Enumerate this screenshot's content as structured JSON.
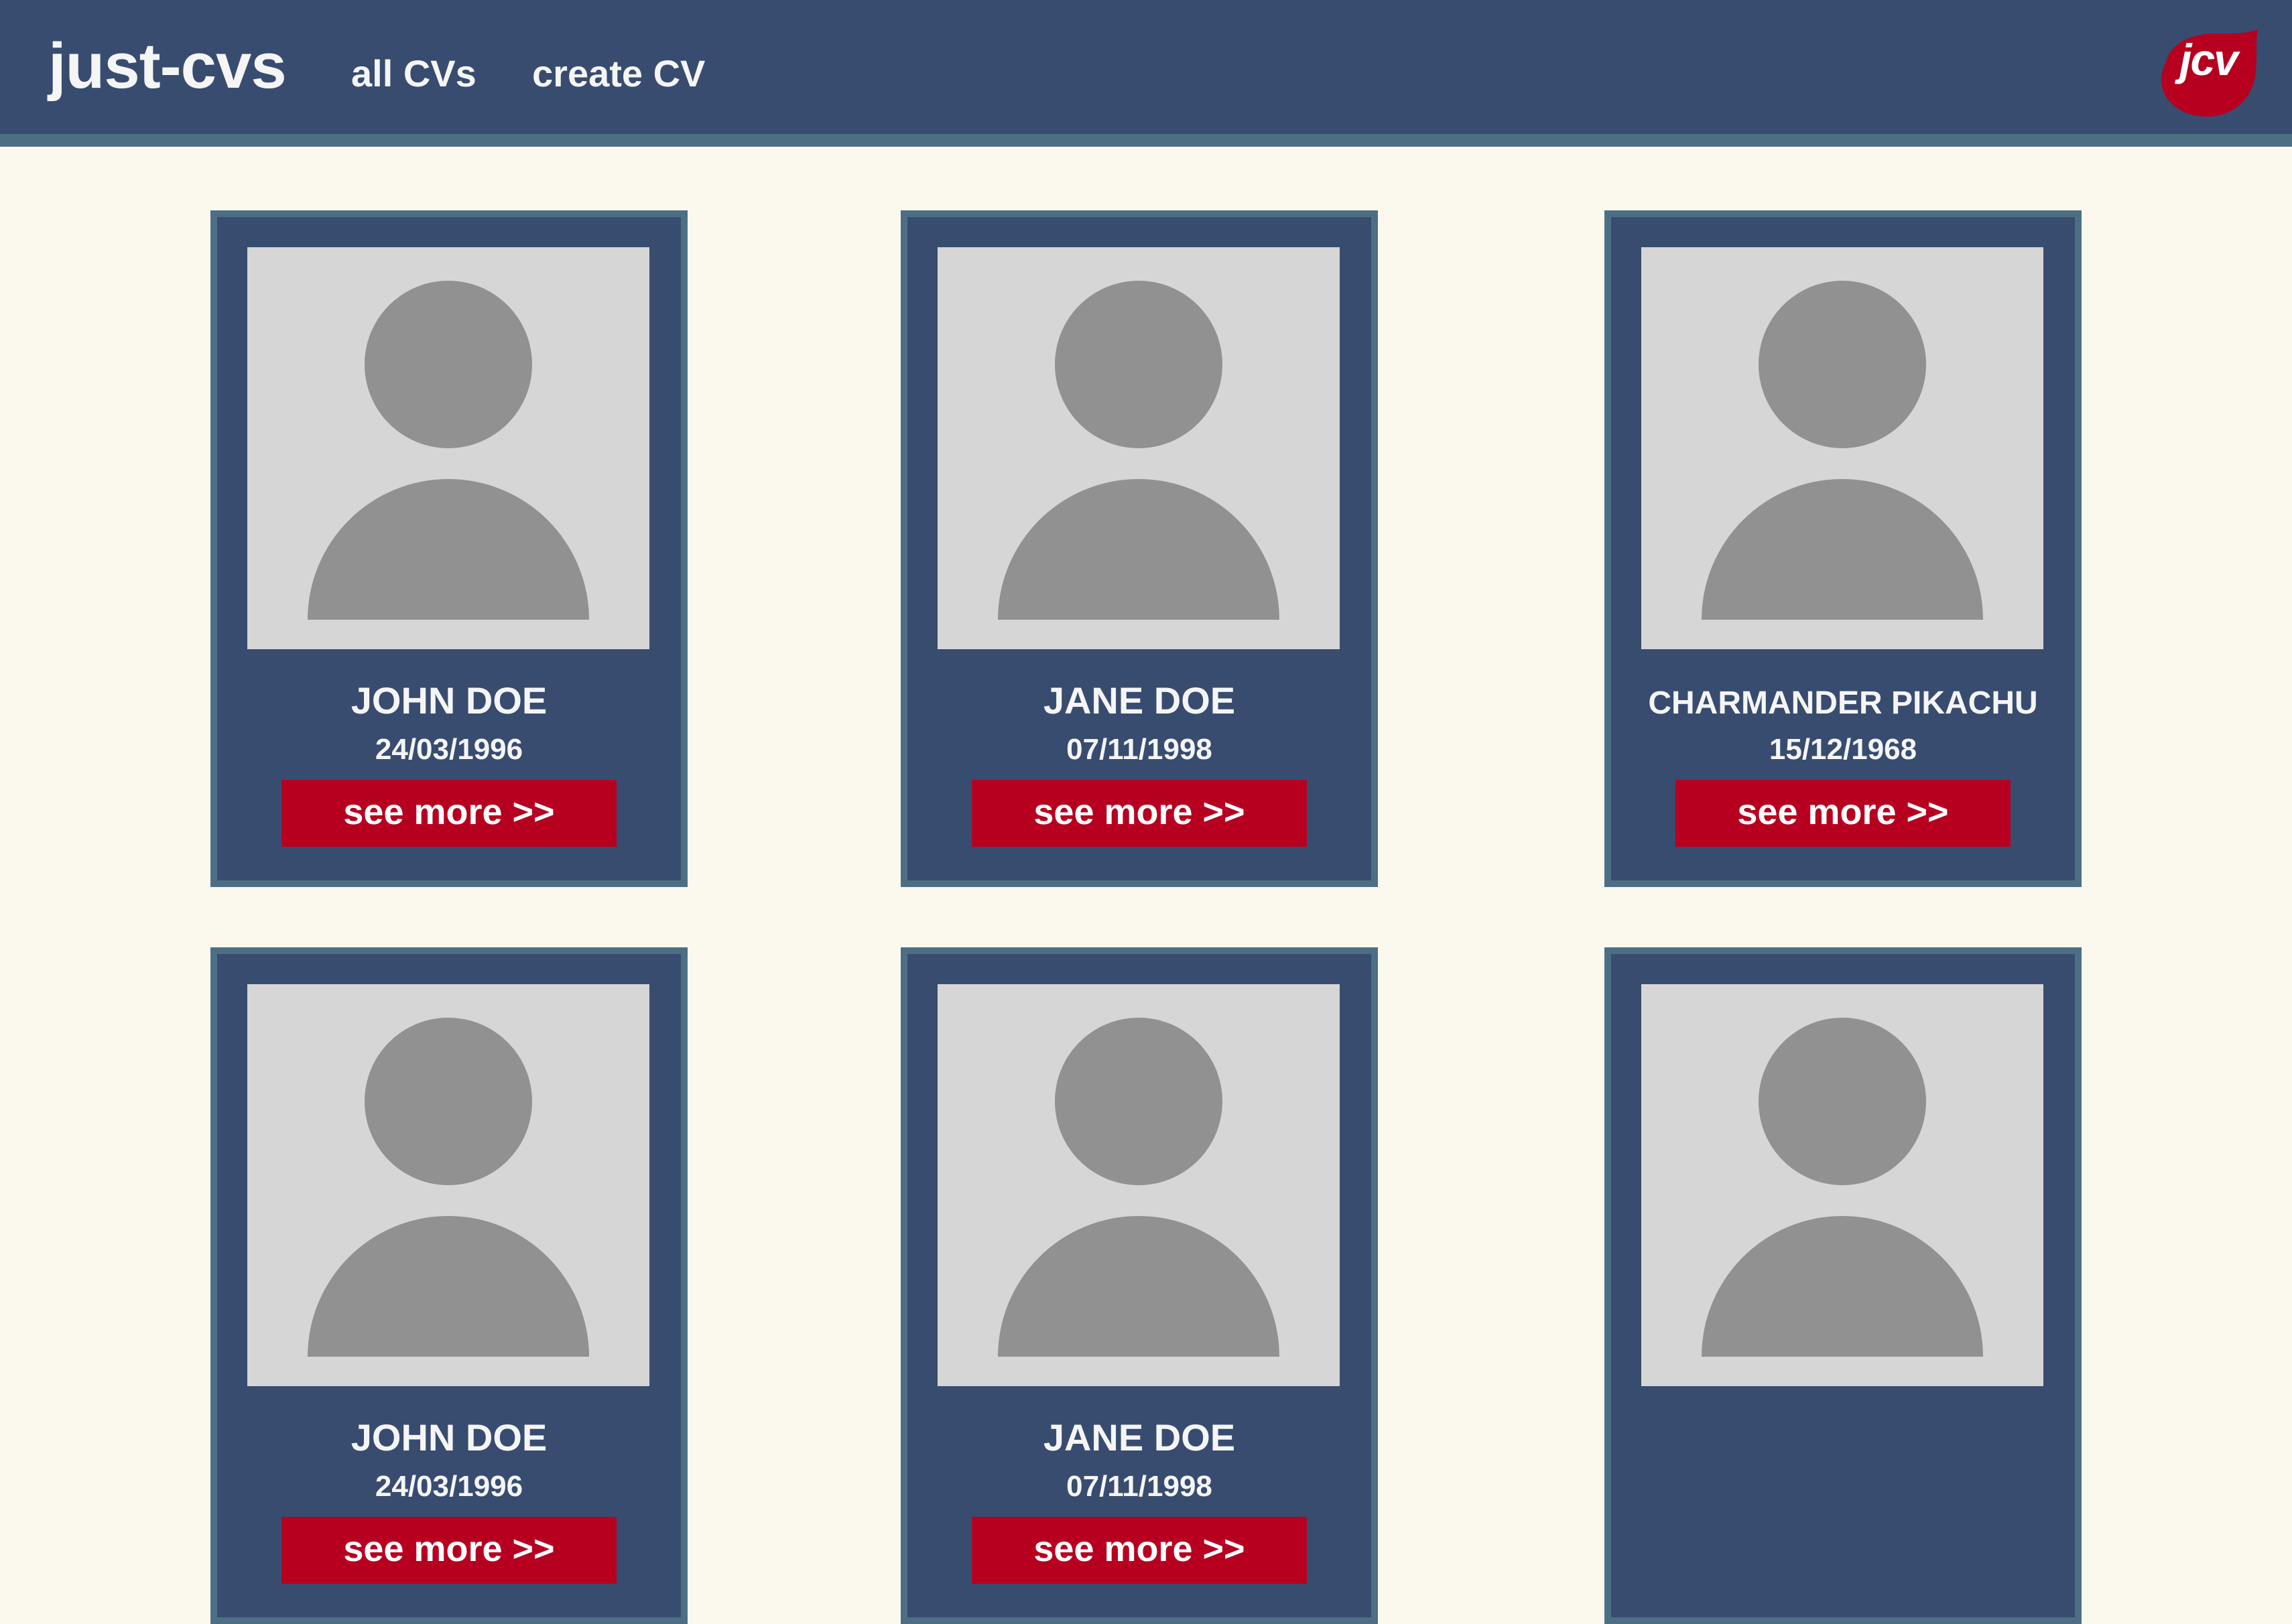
{
  "header": {
    "brand": "just-cvs",
    "nav": [
      "all CVs",
      "create CV"
    ],
    "logo_text": "jcv"
  },
  "colors": {
    "background": "#FBF9EE",
    "header": "#384C70",
    "header_border": "#4C6F84",
    "card": "#384C70",
    "accent": "#B70020",
    "photo_bg": "#D6D6D6",
    "silhouette": "#919191"
  },
  "cards": [
    {
      "name": "JOHN DOE",
      "date": "24/03/1996",
      "button": "see more >>"
    },
    {
      "name": "JANE DOE",
      "date": "07/11/1998",
      "button": "see more >>"
    },
    {
      "name": "CHARMANDER PIKACHU",
      "date": "15/12/1968",
      "button": "see more >>"
    },
    {
      "name": "JOHN DOE",
      "date": "24/03/1996",
      "button": "see more >>"
    },
    {
      "name": "JANE DOE",
      "date": "07/11/1998",
      "button": "see more >>"
    },
    {
      "name": "",
      "date": "",
      "button": ""
    }
  ]
}
